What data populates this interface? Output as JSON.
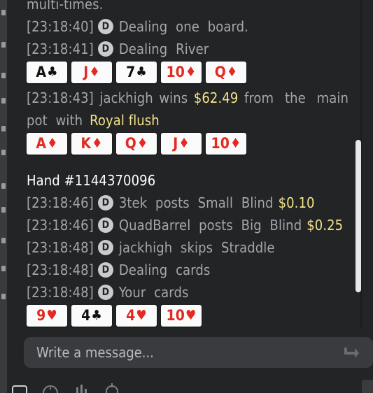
{
  "colors": {
    "amount": "#f3e38a",
    "red_suit": "#e32a22",
    "black_suit": "#111111",
    "panel_bg": "#232426"
  },
  "log": {
    "top_partial": "multi-times.",
    "lines_a": [
      {
        "time": "[23:18:40]",
        "dealer": "D",
        "text": "Dealing one board."
      },
      {
        "time": "[23:18:41]",
        "dealer": "D",
        "text": "Dealing River"
      }
    ],
    "board_cards": [
      {
        "rank": "A",
        "suit": "♣",
        "color": "black"
      },
      {
        "rank": "J",
        "suit": "♦",
        "color": "red"
      },
      {
        "rank": "7",
        "suit": "♣",
        "color": "black"
      },
      {
        "rank": "10",
        "suit": "♦",
        "color": "red"
      },
      {
        "rank": "Q",
        "suit": "♦",
        "color": "red"
      }
    ],
    "win_line": {
      "time": "[23:18:43]",
      "player": "jackhigh",
      "verb": "wins",
      "amount": "$62.49",
      "mid": "from the main",
      "pre2": "pot with",
      "hand": "Royal flush"
    },
    "win_cards": [
      {
        "rank": "A",
        "suit": "♦",
        "color": "red"
      },
      {
        "rank": "K",
        "suit": "♦",
        "color": "red"
      },
      {
        "rank": "Q",
        "suit": "♦",
        "color": "red"
      },
      {
        "rank": "J",
        "suit": "♦",
        "color": "red"
      },
      {
        "rank": "10",
        "suit": "♦",
        "color": "red"
      }
    ],
    "hand_title": "Hand #1144370096",
    "lines_b": [
      {
        "time": "[23:18:46]",
        "dealer": "D",
        "text": "3tek posts Small Blind",
        "amount": "$0.10"
      },
      {
        "time": "[23:18:46]",
        "dealer": "D",
        "text": "QuadBarrel posts Big Blind",
        "amount": "$0.25"
      },
      {
        "time": "[23:18:48]",
        "dealer": "D",
        "text": "jackhigh skips Straddle",
        "amount": ""
      },
      {
        "time": "[23:18:48]",
        "dealer": "D",
        "text": "Dealing cards",
        "amount": ""
      },
      {
        "time": "[23:18:48]",
        "dealer": "D",
        "text": "Your cards",
        "amount": ""
      }
    ],
    "your_cards": [
      {
        "rank": "9",
        "suit": "♥",
        "color": "red"
      },
      {
        "rank": "4",
        "suit": "♣",
        "color": "black"
      },
      {
        "rank": "4",
        "suit": "♥",
        "color": "red"
      },
      {
        "rank": "10",
        "suit": "♥",
        "color": "red"
      }
    ]
  },
  "composer": {
    "placeholder": "Write a message...",
    "send_icon": "send-arrow-icon"
  },
  "bottom_icons": [
    "chat-icon",
    "info-icon",
    "stats-icon",
    "target-icon"
  ]
}
